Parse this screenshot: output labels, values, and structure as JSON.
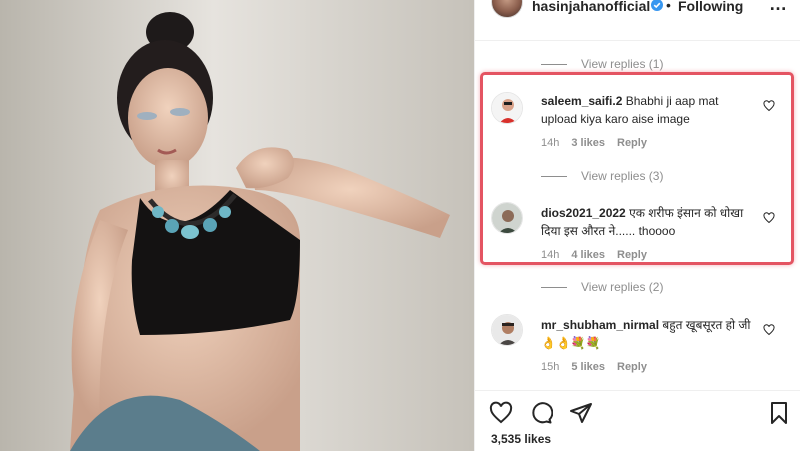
{
  "post": {
    "username": "hasinjahanofficial",
    "separator": "•",
    "follow_status": "Following",
    "more": "…",
    "likes": "3,535 likes"
  },
  "comments": [
    {
      "view_replies": "View replies (1)"
    },
    {
      "username": "saleem_saifi.2",
      "text": "Bhabhi ji aap mat upload kiya karo aise image",
      "time": "14h",
      "likes": "3 likes",
      "reply": "Reply",
      "view_replies": "View replies (3)"
    },
    {
      "username": "dios2021_2022",
      "text": "एक शरीफ इंसान को धोखा दिया इस औरत ने...... thoooo",
      "time": "14h",
      "likes": "4 likes",
      "reply": "Reply",
      "view_replies": "View replies (2)"
    },
    {
      "username": "mr_shubham_nirmal",
      "text": "बहुत खूबसूरत हो जी👌👌💐💐",
      "time": "15h",
      "likes": "5 likes",
      "reply": "Reply"
    }
  ],
  "icons": {
    "like": "heart-icon",
    "comment": "comment-icon",
    "share": "share-icon",
    "save": "bookmark-icon",
    "verified": "verified-badge-icon",
    "comment_like": "heart-small-icon"
  },
  "colors": {
    "highlight_border": "#e45462",
    "verified_blue": "#3897f0",
    "muted_text": "#8e8e8e"
  }
}
